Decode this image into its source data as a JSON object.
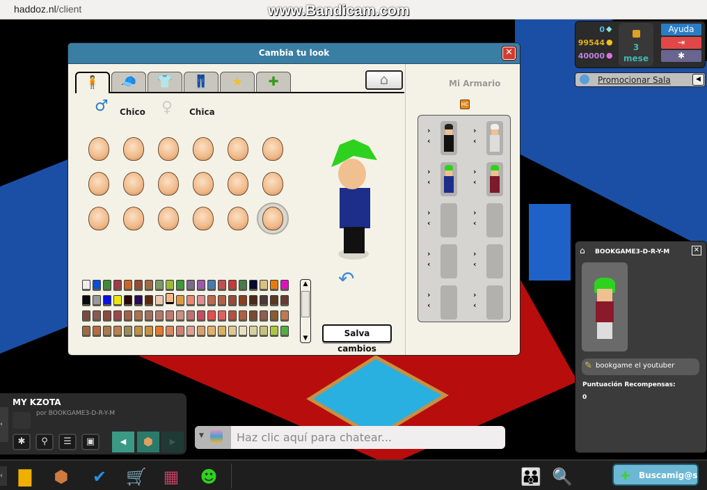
{
  "browser": {
    "url_domain": "haddoz.nl",
    "url_path": "/client"
  },
  "watermark": "www.Bandicam.com",
  "dialog": {
    "title": "Cambia tu look",
    "close_icon": "close-icon",
    "tabs": [
      {
        "icon": "body-icon",
        "glyph": "🧍",
        "active": true
      },
      {
        "icon": "cap-icon",
        "glyph": "🧢"
      },
      {
        "icon": "shirt-icon",
        "glyph": "👕"
      },
      {
        "icon": "pants-icon",
        "glyph": "👖"
      },
      {
        "icon": "star-icon",
        "glyph": "★"
      },
      {
        "icon": "effects-icon",
        "glyph": "✚"
      }
    ],
    "hanger_icon": "hanger-icon",
    "gender": {
      "male": "Chico",
      "female": "Chica",
      "selected": "male"
    },
    "heads": {
      "count": 18,
      "selected_index": 17
    },
    "palette": [
      [
        "#eeeeee",
        "#0a4fd6",
        "#3f8a3a",
        "#9a3d4a",
        "#c8662a",
        "#9a4a30",
        "#a06a45",
        "#7a9a6a",
        "#9ab83a",
        "#3a9a3a",
        "#7a6a8a",
        "#9a5aa8",
        "#4a7aa8",
        "#c05050",
        "#c83a3a",
        "#4a7a4a",
        "#0a0a30",
        "#d8c080",
        "#e87a10",
        "#e010c0"
      ],
      [
        "#0a0a0a",
        "#999999",
        "#0a10e0",
        "#e8e810",
        "#2a0808",
        "#2a0a5a",
        "#5a2a10",
        "#e8c8b0",
        "#f0b888",
        "#e09840",
        "#e88870",
        "#d89090",
        "#b86a50",
        "#b06048",
        "#9a4a38",
        "#8a4020",
        "#4a2a18",
        "#4a3a38",
        "#5a3a20",
        "#6a3a30"
      ],
      [
        "#7a4a40",
        "#8a5a50",
        "#8a4a40",
        "#9a4a4a",
        "#a06050",
        "#b07050",
        "#a07060",
        "#b07a70",
        "#c07a70",
        "#c89080",
        "#c07070",
        "#c05060",
        "#e05050",
        "#e06060",
        "#b85040",
        "#b06040",
        "#7a4a30",
        "#8a6050",
        "#8a5a30",
        "#c07a50"
      ],
      [
        "#a06a40",
        "#b86a40",
        "#a87a50",
        "#b88050",
        "#9a8a60",
        "#c09040",
        "#c89040",
        "#e07a30",
        "#d88860",
        "#d08070",
        "#e0a090",
        "#d8a070",
        "#e0b070",
        "#d8b060",
        "#e0c890",
        "#e8e0c0",
        "#d8d0a0",
        "#c8c080",
        "#a8c840",
        "#50b040"
      ]
    ],
    "selected_color": "#f0b888",
    "save_label": "Salva cambios",
    "wardrobe": {
      "title": "Mi Armario",
      "slots": [
        [
          "dark-outfit",
          "white-mannequin"
        ],
        [
          "green-hair-blue-shirt",
          "green-hair-red-shirt"
        ],
        [
          "empty",
          "empty"
        ],
        [
          "empty",
          "empty"
        ],
        [
          "empty",
          "empty"
        ]
      ]
    }
  },
  "hud": {
    "diamonds": "0",
    "credits": "99544",
    "duckets": "40000",
    "hc": {
      "value": "3",
      "unit": "mese"
    },
    "help": "Ayuda",
    "colors": {
      "help": "#2a7dc4",
      "logout": "#e04848",
      "settings": "#6a6490"
    }
  },
  "promo": {
    "label": "Promocionar Sala"
  },
  "profile": {
    "name": "BOOKGAME3-D-R-Y-M",
    "motto": "bookgame el youtuber",
    "rewards_label": "Puntuación Recompensas:",
    "rewards_value": "0"
  },
  "room": {
    "name": "MY KZOTA",
    "owner": "por BOOKGAME3-D-R-Y-M"
  },
  "chat": {
    "placeholder": "Haz clic aquí para chatear..."
  },
  "toolbar": {
    "find_friends": "Buscamig@s"
  }
}
